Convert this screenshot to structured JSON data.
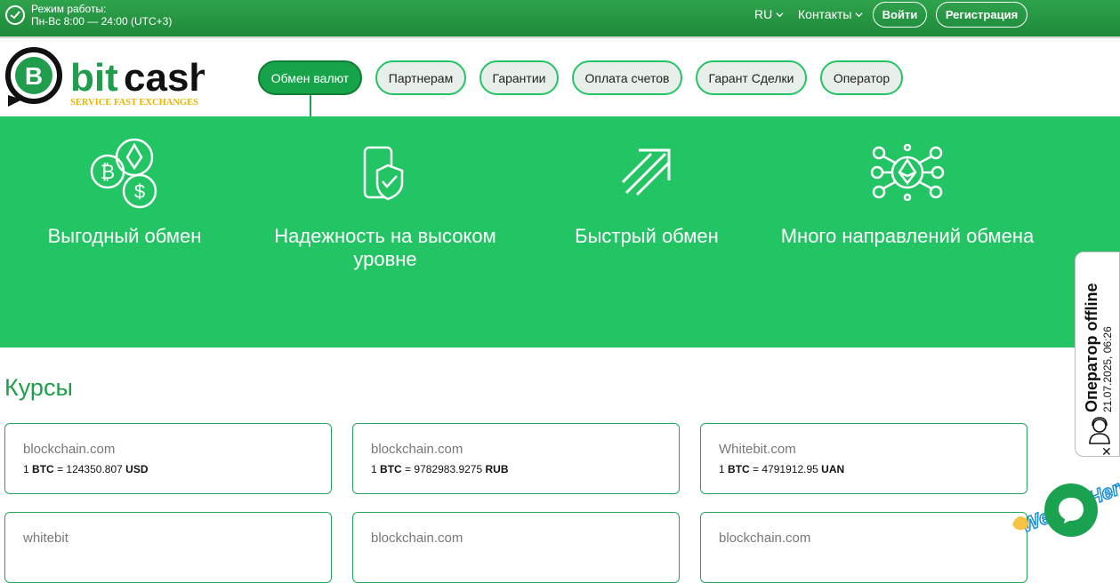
{
  "topbar": {
    "hours_line1": "Режим работы:",
    "hours_line2": "Пн-Вс 8:00 — 24:00 (UTC+3)",
    "lang": "RU",
    "contacts": "Контакты",
    "login": "Войти",
    "register": "Регистрация"
  },
  "logo": {
    "name": "bitcash",
    "tagline": "SERVICE FAST EXCHANGES"
  },
  "nav": [
    {
      "label": "Обмен валют",
      "active": true
    },
    {
      "label": "Партнерам"
    },
    {
      "label": "Гарантии"
    },
    {
      "label": "Оплата счетов"
    },
    {
      "label": "Гарант Сделки"
    },
    {
      "label": "Оператор"
    }
  ],
  "features": [
    {
      "label": "Выгодный обмен",
      "icon": "crypto-coins-icon"
    },
    {
      "label": "Надежность на высоком уровне",
      "icon": "phone-shield-icon"
    },
    {
      "label": "Быстрый обмен",
      "icon": "fast-arrow-icon"
    },
    {
      "label": "Много направлений обмена",
      "icon": "ethereum-network-icon"
    }
  ],
  "courses": {
    "title": "Курсы",
    "cards": [
      {
        "source": "blockchain.com",
        "amount": "1",
        "from": "BTC",
        "eq": "=",
        "value": "124350.807",
        "to": "USD"
      },
      {
        "source": "blockchain.com",
        "amount": "1",
        "from": "BTC",
        "eq": "=",
        "value": "9782983.9275",
        "to": "RUB"
      },
      {
        "source": "Whitebit.com",
        "amount": "1",
        "from": "BTC",
        "eq": "=",
        "value": "4791912.95",
        "to": "UAN"
      },
      {
        "source": "whitebit"
      },
      {
        "source": "blockchain.com"
      },
      {
        "source": "blockchain.com"
      }
    ]
  },
  "operator": {
    "status": "Оператор offline",
    "time": "21.07.2025, 06:26",
    "close": "✕"
  },
  "chat": {
    "weare": "We Are Here!"
  },
  "colors": {
    "brand_green": "#23c464",
    "dark_green": "#16a34a",
    "logo_yellow": "#e8b400"
  }
}
